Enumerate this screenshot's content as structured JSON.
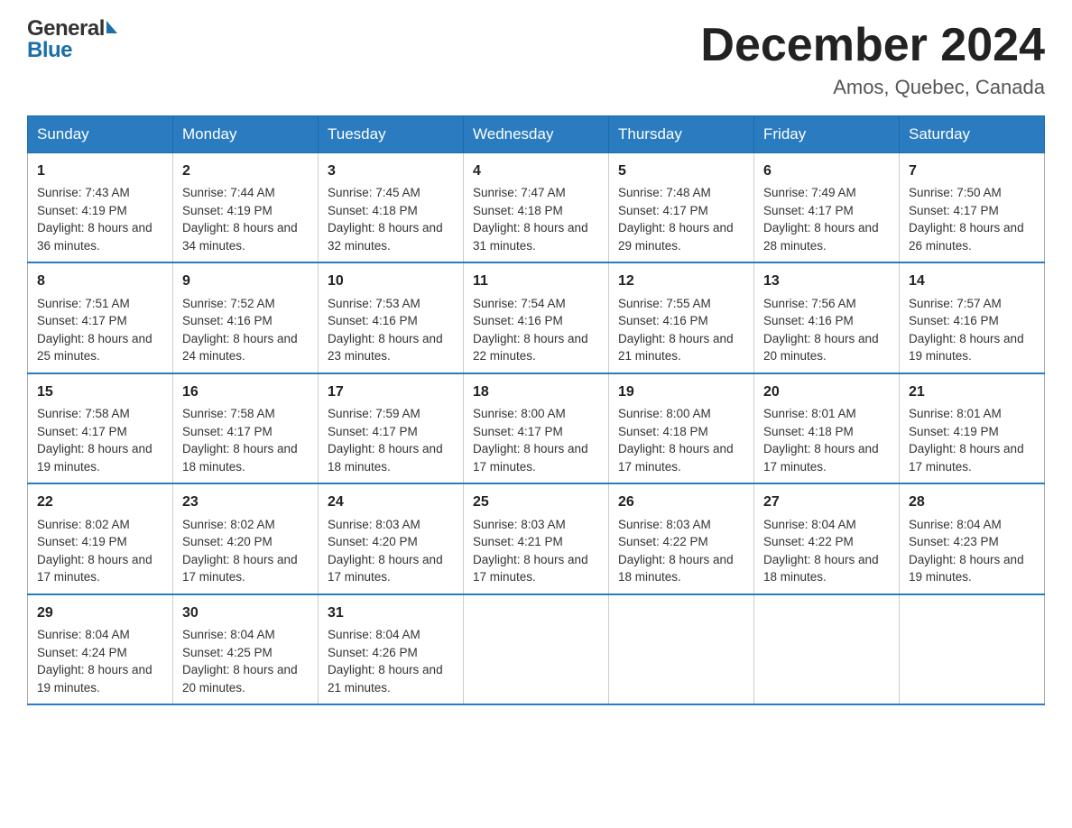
{
  "logo": {
    "general": "General",
    "blue": "Blue"
  },
  "header": {
    "month": "December 2024",
    "location": "Amos, Quebec, Canada"
  },
  "weekdays": [
    "Sunday",
    "Monday",
    "Tuesday",
    "Wednesday",
    "Thursday",
    "Friday",
    "Saturday"
  ],
  "weeks": [
    [
      {
        "day": "1",
        "sunrise": "7:43 AM",
        "sunset": "4:19 PM",
        "daylight": "8 hours and 36 minutes."
      },
      {
        "day": "2",
        "sunrise": "7:44 AM",
        "sunset": "4:19 PM",
        "daylight": "8 hours and 34 minutes."
      },
      {
        "day": "3",
        "sunrise": "7:45 AM",
        "sunset": "4:18 PM",
        "daylight": "8 hours and 32 minutes."
      },
      {
        "day": "4",
        "sunrise": "7:47 AM",
        "sunset": "4:18 PM",
        "daylight": "8 hours and 31 minutes."
      },
      {
        "day": "5",
        "sunrise": "7:48 AM",
        "sunset": "4:17 PM",
        "daylight": "8 hours and 29 minutes."
      },
      {
        "day": "6",
        "sunrise": "7:49 AM",
        "sunset": "4:17 PM",
        "daylight": "8 hours and 28 minutes."
      },
      {
        "day": "7",
        "sunrise": "7:50 AM",
        "sunset": "4:17 PM",
        "daylight": "8 hours and 26 minutes."
      }
    ],
    [
      {
        "day": "8",
        "sunrise": "7:51 AM",
        "sunset": "4:17 PM",
        "daylight": "8 hours and 25 minutes."
      },
      {
        "day": "9",
        "sunrise": "7:52 AM",
        "sunset": "4:16 PM",
        "daylight": "8 hours and 24 minutes."
      },
      {
        "day": "10",
        "sunrise": "7:53 AM",
        "sunset": "4:16 PM",
        "daylight": "8 hours and 23 minutes."
      },
      {
        "day": "11",
        "sunrise": "7:54 AM",
        "sunset": "4:16 PM",
        "daylight": "8 hours and 22 minutes."
      },
      {
        "day": "12",
        "sunrise": "7:55 AM",
        "sunset": "4:16 PM",
        "daylight": "8 hours and 21 minutes."
      },
      {
        "day": "13",
        "sunrise": "7:56 AM",
        "sunset": "4:16 PM",
        "daylight": "8 hours and 20 minutes."
      },
      {
        "day": "14",
        "sunrise": "7:57 AM",
        "sunset": "4:16 PM",
        "daylight": "8 hours and 19 minutes."
      }
    ],
    [
      {
        "day": "15",
        "sunrise": "7:58 AM",
        "sunset": "4:17 PM",
        "daylight": "8 hours and 19 minutes."
      },
      {
        "day": "16",
        "sunrise": "7:58 AM",
        "sunset": "4:17 PM",
        "daylight": "8 hours and 18 minutes."
      },
      {
        "day": "17",
        "sunrise": "7:59 AM",
        "sunset": "4:17 PM",
        "daylight": "8 hours and 18 minutes."
      },
      {
        "day": "18",
        "sunrise": "8:00 AM",
        "sunset": "4:17 PM",
        "daylight": "8 hours and 17 minutes."
      },
      {
        "day": "19",
        "sunrise": "8:00 AM",
        "sunset": "4:18 PM",
        "daylight": "8 hours and 17 minutes."
      },
      {
        "day": "20",
        "sunrise": "8:01 AM",
        "sunset": "4:18 PM",
        "daylight": "8 hours and 17 minutes."
      },
      {
        "day": "21",
        "sunrise": "8:01 AM",
        "sunset": "4:19 PM",
        "daylight": "8 hours and 17 minutes."
      }
    ],
    [
      {
        "day": "22",
        "sunrise": "8:02 AM",
        "sunset": "4:19 PM",
        "daylight": "8 hours and 17 minutes."
      },
      {
        "day": "23",
        "sunrise": "8:02 AM",
        "sunset": "4:20 PM",
        "daylight": "8 hours and 17 minutes."
      },
      {
        "day": "24",
        "sunrise": "8:03 AM",
        "sunset": "4:20 PM",
        "daylight": "8 hours and 17 minutes."
      },
      {
        "day": "25",
        "sunrise": "8:03 AM",
        "sunset": "4:21 PM",
        "daylight": "8 hours and 17 minutes."
      },
      {
        "day": "26",
        "sunrise": "8:03 AM",
        "sunset": "4:22 PM",
        "daylight": "8 hours and 18 minutes."
      },
      {
        "day": "27",
        "sunrise": "8:04 AM",
        "sunset": "4:22 PM",
        "daylight": "8 hours and 18 minutes."
      },
      {
        "day": "28",
        "sunrise": "8:04 AM",
        "sunset": "4:23 PM",
        "daylight": "8 hours and 19 minutes."
      }
    ],
    [
      {
        "day": "29",
        "sunrise": "8:04 AM",
        "sunset": "4:24 PM",
        "daylight": "8 hours and 19 minutes."
      },
      {
        "day": "30",
        "sunrise": "8:04 AM",
        "sunset": "4:25 PM",
        "daylight": "8 hours and 20 minutes."
      },
      {
        "day": "31",
        "sunrise": "8:04 AM",
        "sunset": "4:26 PM",
        "daylight": "8 hours and 21 minutes."
      },
      null,
      null,
      null,
      null
    ]
  ],
  "labels": {
    "sunrise": "Sunrise: ",
    "sunset": "Sunset: ",
    "daylight": "Daylight: "
  },
  "colors": {
    "header_bg": "#2a7bbf",
    "border_accent": "#2a7bbf"
  }
}
